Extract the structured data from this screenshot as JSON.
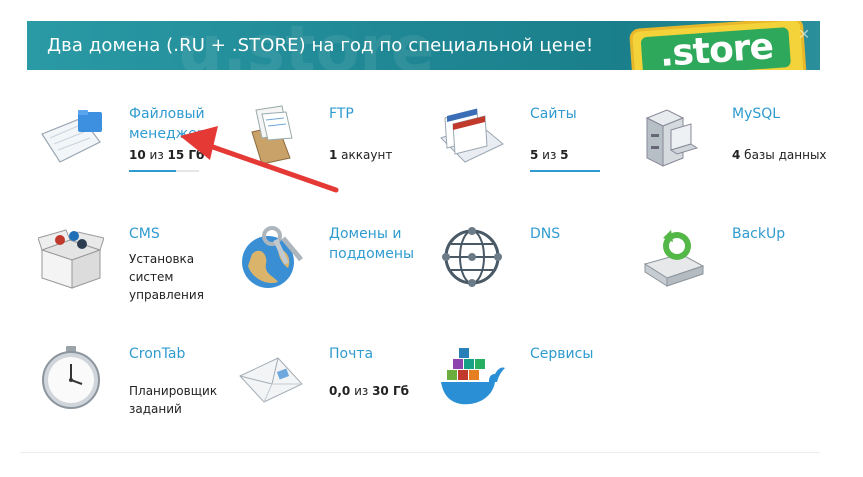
{
  "banner": {
    "text": "Два домена (.RU + .STORE) на год по специальной цене!",
    "ghost": "u.store",
    "badge": ".store",
    "close": "✕"
  },
  "tiles": {
    "filemanager": {
      "name": "Файловый менеджер",
      "used": "10",
      "sep": " из ",
      "total": "15 Гб",
      "progress": 0.67
    },
    "ftp": {
      "name": "FTP",
      "count": "1",
      "unit": " аккаунт"
    },
    "sites": {
      "name": "Сайты",
      "used": "5",
      "sep": " из ",
      "total": "5",
      "progress": 1.0
    },
    "mysql": {
      "name": "MySQL",
      "count": "4",
      "unit": " базы данных"
    },
    "cms": {
      "name": "CMS",
      "desc": "Установка систем управления"
    },
    "domains": {
      "name": "Домены и поддомены"
    },
    "dns": {
      "name": "DNS"
    },
    "backup": {
      "name": "BackUp"
    },
    "crontab": {
      "name": "CronTab",
      "desc": "Планировщик заданий"
    },
    "mail": {
      "name": "Почта",
      "used": "0,0",
      "sep": " из ",
      "total": "30 Гб"
    },
    "services": {
      "name": "Сервисы"
    }
  },
  "colors": {
    "link": "#2f9bd0",
    "arrow": "#e53935",
    "banner": "#1f8894"
  }
}
